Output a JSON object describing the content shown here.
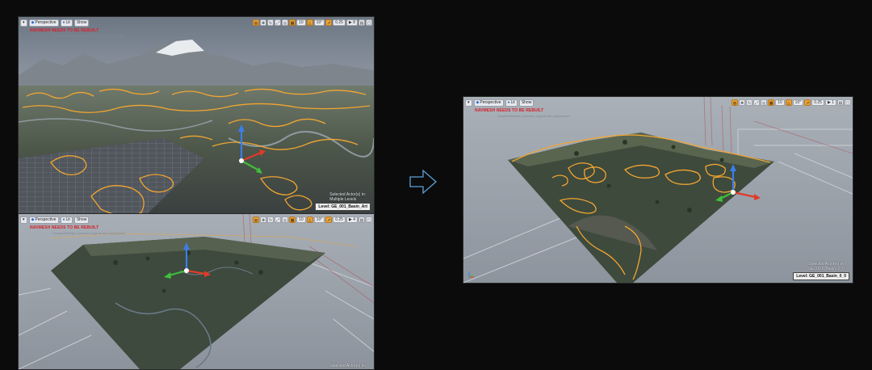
{
  "toolbar": {
    "menu_glyph": "▾",
    "perspective_label": "Perspective",
    "lit_label": "Lit",
    "show_label": "Show",
    "icons": [
      "globe-icon",
      "move-icon",
      "rotate-icon",
      "scale-icon",
      "grid-icon",
      "angle-icon",
      "camera-speed-icon",
      "layout-icon",
      "maximize-icon"
    ]
  },
  "viewports": {
    "top_left": {
      "warning": "NAVMESH NEEDS TO BE REBUILT",
      "subwarning": "Disabled/Hidden navmesh regions are suppressed",
      "grid_value": "10",
      "angle_value": "10°",
      "scale_value": "0.25",
      "camera_speed": "8",
      "selected_line1": "Selected Actor(s) in:",
      "selected_line2": "Multiple Levels",
      "level_label": "Level: GE_001_Basin_Art"
    },
    "bottom_left": {
      "warning": "NAVMESH NEEDS TO BE REBUILT",
      "subwarning": "Disabled/Hidden navmesh regions are suppressed",
      "grid_value": "10",
      "angle_value": "10°",
      "scale_value": "0.25",
      "camera_speed": "4",
      "selected_line1": "Selected Actor(s) in:"
    },
    "right": {
      "warning": "NAVMESH NEEDS TO BE REBUILT",
      "subwarning": "Disabled/Hidden navmesh regions are suppressed",
      "grid_value": "10",
      "angle_value": "10°",
      "scale_value": "0.25",
      "camera_speed": "1",
      "selected_line1": "Selected Actor(s) in:",
      "selected_line2": "GE_001_Basin_0_0",
      "level_label": "Level: GE_001_Basin_0_0"
    }
  },
  "colors": {
    "navmesh_outline": "#f2a531",
    "warning_red": "#d9202a",
    "floor_gray": "#9aa2ab",
    "terrain_green": "#3d4a3d",
    "gizmo_x": "#e03a2a",
    "gizmo_y": "#3fbf3a",
    "gizmo_z": "#3b7ee8"
  },
  "arrow": {
    "icon": "arrow-right-icon"
  }
}
